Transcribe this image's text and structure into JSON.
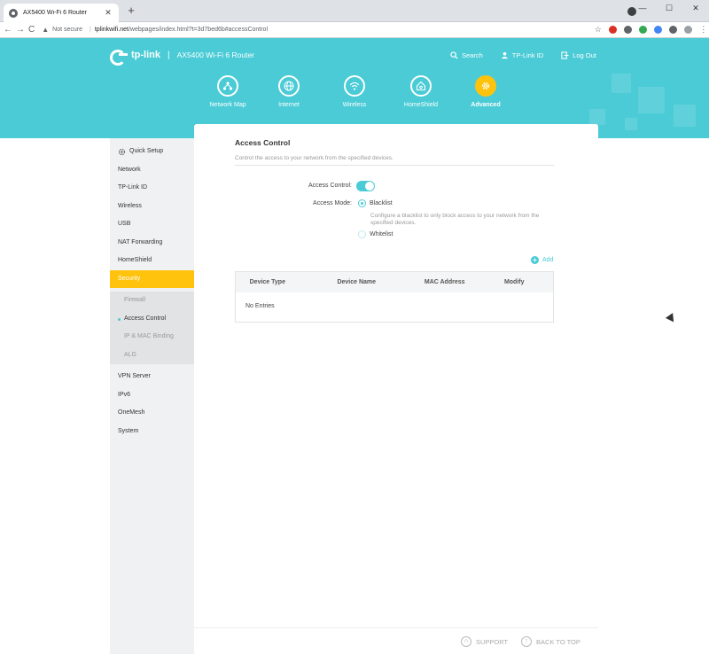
{
  "browser": {
    "tab_title": "AX5400 Wi-Fi 6 Router",
    "tab_close": "✕",
    "new_tab": "+",
    "window_controls": [
      "—",
      "☐",
      "✕"
    ],
    "nav": {
      "back": "←",
      "forward": "→",
      "reload": "C"
    },
    "omnibox": {
      "warning_icon": "▲",
      "not_secure": "Not secure",
      "separator": "|",
      "url_host": "tplinkwifi.net",
      "url_path": "/webpages/index.html?t=3d7bed6b#accessControl"
    },
    "extensions": [
      {
        "name": "star-icon",
        "glyph": "☆",
        "color": "#ffffff"
      },
      {
        "name": "adblock-icon",
        "glyph": "",
        "color": "#d93025"
      },
      {
        "name": "privacy-icon",
        "glyph": "",
        "color": "#5f6368"
      },
      {
        "name": "drive-icon",
        "glyph": "",
        "color": "#34a853"
      },
      {
        "name": "extension-icon",
        "glyph": "",
        "color": "#4285f4"
      },
      {
        "name": "puzzle-icon",
        "glyph": "",
        "color": "#5f6368"
      },
      {
        "name": "profile-icon",
        "glyph": "",
        "color": "#9aa0a6"
      },
      {
        "name": "menu-icon",
        "glyph": "⋮",
        "color": "#ffffff"
      }
    ]
  },
  "header": {
    "logo_text": "tp-link",
    "divider": "|",
    "model": "AX5400 Wi-Fi 6 Router",
    "links": {
      "search": "Search",
      "tplink_id": "TP-Link ID",
      "logout": "Log Out"
    },
    "nav": [
      {
        "label": "Network Map"
      },
      {
        "label": "Internet"
      },
      {
        "label": "Wireless"
      },
      {
        "label": "HomeShield"
      },
      {
        "label": "Advanced"
      }
    ],
    "colors": {
      "brand": "#4acbd6",
      "accent": "#ffc30e"
    }
  },
  "sidebar": {
    "items_top": [
      {
        "label": "Quick Setup"
      },
      {
        "label": "Network"
      },
      {
        "label": "TP-Link ID"
      },
      {
        "label": "Wireless"
      },
      {
        "label": "USB"
      },
      {
        "label": "NAT Forwarding"
      },
      {
        "label": "HomeShield"
      },
      {
        "label": "Security"
      }
    ],
    "sub_items": [
      {
        "label": "Firewall"
      },
      {
        "label": "Access Control"
      },
      {
        "label": "IP & MAC Binding"
      },
      {
        "label": "ALG"
      }
    ],
    "items_bottom": [
      {
        "label": "VPN Server"
      },
      {
        "label": "IPv6"
      },
      {
        "label": "OneMesh"
      },
      {
        "label": "System"
      }
    ]
  },
  "main": {
    "title": "Access Control",
    "description": "Control the access to your network from the specified devices.",
    "access_control_label": "Access Control:",
    "access_control_enabled": true,
    "access_mode_label": "Access Mode:",
    "modes": {
      "blacklist": "Blacklist",
      "blacklist_hint": "Configure a blacklist to only block access to your network from the specified devices.",
      "whitelist": "Whitelist"
    },
    "add_label": "Add",
    "table": {
      "headers": [
        "Device Type",
        "Device Name",
        "MAC Address",
        "Modify"
      ],
      "empty": "No Entries"
    }
  },
  "footer": {
    "support": "SUPPORT",
    "back_to_top": "BACK TO TOP"
  }
}
